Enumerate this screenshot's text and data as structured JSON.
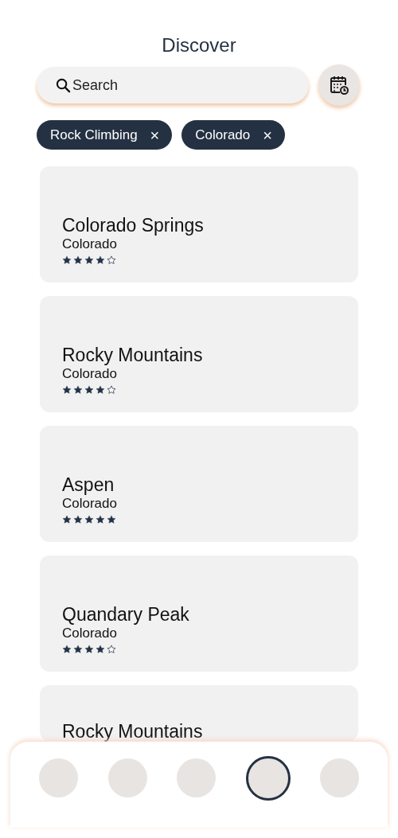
{
  "header": {
    "title": "Discover"
  },
  "search": {
    "placeholder": "Search"
  },
  "filters": [
    {
      "label": "Rock Climbing",
      "remove": "×"
    },
    {
      "label": "Colorado",
      "remove": "×"
    }
  ],
  "places": [
    {
      "name": "Colorado Springs",
      "region": "Colorado",
      "stars": 4
    },
    {
      "name": "Rocky Mountains",
      "region": "Colorado",
      "stars": 4
    },
    {
      "name": "Aspen",
      "region": "Colorado",
      "stars": 5
    },
    {
      "name": "Quandary Peak",
      "region": "Colorado",
      "stars": 4
    },
    {
      "name": "Rocky Mountains"
    }
  ],
  "nav": [
    {
      "selected": false
    },
    {
      "selected": false
    },
    {
      "selected": false
    },
    {
      "selected": true
    },
    {
      "selected": false
    }
  ]
}
